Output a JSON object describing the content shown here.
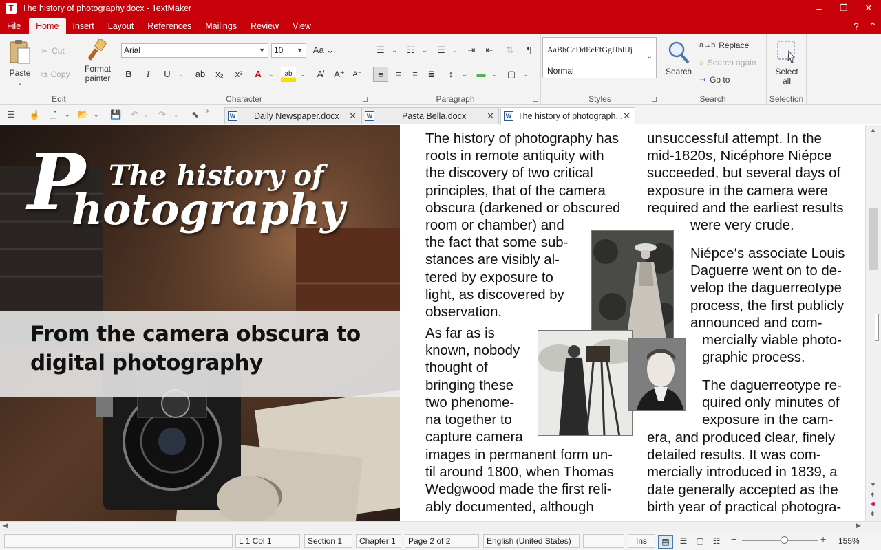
{
  "window": {
    "title": "The history of photography.docx - TextMaker",
    "app_icon_letter": "T",
    "controls": [
      "–",
      "❐",
      "✕"
    ]
  },
  "menu": {
    "items": [
      "File",
      "Home",
      "Insert",
      "Layout",
      "References",
      "Mailings",
      "Review",
      "View"
    ],
    "active": "Home",
    "help": "?"
  },
  "ribbon": {
    "edit": {
      "label": "Edit",
      "paste": "Paste",
      "cut": "Cut",
      "copy": "Copy",
      "format_painter_1": "Format",
      "format_painter_2": "painter"
    },
    "character": {
      "label": "Character",
      "font_name": "Arial",
      "font_size": "10",
      "bold": "B",
      "italic": "I",
      "underline": "U",
      "strike": "ab",
      "subscript": "x₂",
      "superscript": "x²",
      "font_color": "A",
      "highlight": "ab"
    },
    "paragraph": {
      "label": "Paragraph"
    },
    "styles": {
      "label": "Styles",
      "preview": "AaBbCcDdEeFfGgHhIiJj",
      "current": "Normal"
    },
    "search": {
      "label": "Search",
      "search_btn": "Search",
      "replace": "Replace",
      "search_again": "Search again",
      "goto": "Go to"
    },
    "selection": {
      "label": "Selection",
      "select_all_1": "Select",
      "select_all_2": "all"
    }
  },
  "tabs": [
    {
      "label": "Daily Newspaper.docx",
      "active": false
    },
    {
      "label": "Pasta Bella.docx",
      "active": false
    },
    {
      "label": "The history of photograph...",
      "active": true
    }
  ],
  "document": {
    "title_line1": "The history of",
    "title_line2": "Photography",
    "banner_line1": "From the camera obscura to",
    "banner_line2": "digital photography",
    "col1": [
      "The history of photography has",
      "roots in remote antiquity with",
      "the discovery of two critical",
      "principles, that of the camera",
      "obscura (darkened or obscured",
      "room or chamber) and",
      "the fact that some sub-",
      "stances are visibly al-",
      "tered by exposure to",
      "light, as discovered by",
      "observation."
    ],
    "col1b": [
      "As far as is",
      "known, nobody",
      "thought of",
      "bringing these",
      "two phenome-",
      "na together to",
      "capture camera"
    ],
    "col1c": [
      "images in permanent form un-",
      "til around 1800, when Thomas",
      "Wedgwood made the first reli-",
      "ably documented, although"
    ],
    "col2a": [
      "unsuccessful attempt. In the",
      "mid-1820s, Nicéphore Niépce",
      "succeeded, but several days of",
      "exposure in the camera were",
      "required and the earliest results"
    ],
    "col2a_indent": "were very crude.",
    "col2b": [
      "Niépce‘s associate Louis",
      "Daguerre went on to de-",
      "velop the daguerreotype",
      "process, the first publicly",
      "announced and com-"
    ],
    "col2c": [
      "mercially viable photo-",
      "graphic process."
    ],
    "col2d": [
      "The daguerreotype re-",
      "quired only minutes of",
      "exposure in the cam-"
    ],
    "col2e": [
      "era, and produced clear, finely",
      "detailed results. It was com-",
      "mercially introduced in 1839, a",
      "date generally accepted as the",
      "birth year of practical photogra-"
    ]
  },
  "status": {
    "position": "L 1 Col 1",
    "section": "Section 1",
    "chapter": "Chapter 1",
    "page": "Page 2 of 2",
    "language": "English (United States)",
    "mode": "Ins",
    "zoom": "155%"
  },
  "colors": {
    "brand_red": "#c8000a",
    "ribbon_bg": "#f3f3f3"
  }
}
